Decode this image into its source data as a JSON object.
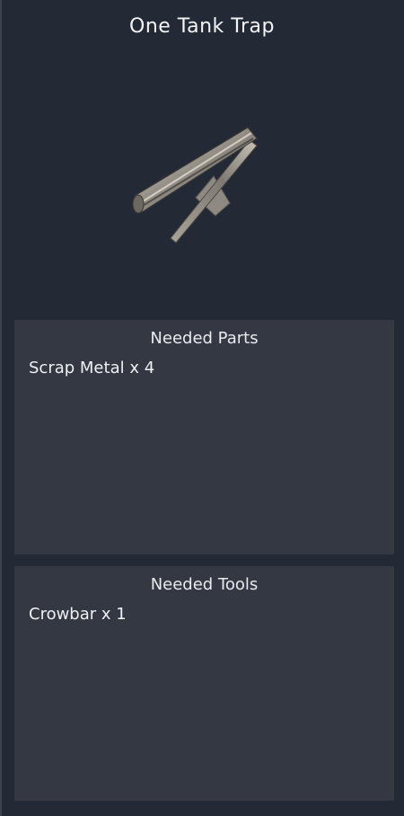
{
  "recipe": {
    "title": "One Tank Trap",
    "image_icon": "tank-trap-icon"
  },
  "parts_panel": {
    "heading": "Needed Parts",
    "items": [
      "Scrap Metal x 4"
    ]
  },
  "tools_panel": {
    "heading": "Needed Tools",
    "items": [
      "Crowbar x 1"
    ]
  },
  "colors": {
    "background": "#242a35",
    "panel": "#333843",
    "text": "#f0f2f5"
  }
}
